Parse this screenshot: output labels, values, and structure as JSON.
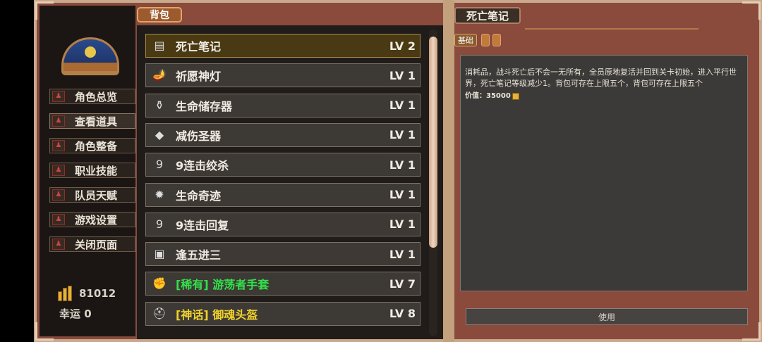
{
  "sidebar": {
    "nav": [
      {
        "label": "角色总览"
      },
      {
        "label": "查看道具"
      },
      {
        "label": "角色整备"
      },
      {
        "label": "职业技能"
      },
      {
        "label": "队员天赋"
      },
      {
        "label": "游戏设置"
      },
      {
        "label": "关闭页面"
      }
    ],
    "gold": "81012",
    "luck": "幸运 0"
  },
  "bag": {
    "tab_label": "背包",
    "items": [
      {
        "name": "死亡笔记",
        "level": "LV 2",
        "icon": "book-icon",
        "glyph": "▤"
      },
      {
        "name": "祈愿神灯",
        "level": "LV 1",
        "icon": "lamp-icon",
        "glyph": "🪔"
      },
      {
        "name": "生命储存器",
        "level": "LV 1",
        "icon": "vessel-icon",
        "glyph": "⚱"
      },
      {
        "name": "减伤圣器",
        "level": "LV 1",
        "icon": "relic-icon",
        "glyph": "◆"
      },
      {
        "name": "9连击绞杀",
        "level": "LV 1",
        "icon": "nine-icon",
        "glyph": "9"
      },
      {
        "name": "生命奇迹",
        "level": "LV 1",
        "icon": "gem-icon",
        "glyph": "✹"
      },
      {
        "name": "9连击回复",
        "level": "LV 1",
        "icon": "nine-small-icon",
        "glyph": "9"
      },
      {
        "name": "逢五进三",
        "level": "LV 1",
        "icon": "card-icon",
        "glyph": "▣"
      },
      {
        "name": "[稀有] 游荡者手套",
        "level": "LV 7",
        "icon": "glove-icon",
        "glyph": "✊",
        "rarity": "rare"
      },
      {
        "name": "[神话] 御魂头盔",
        "level": "LV 8",
        "icon": "helmet-icon",
        "glyph": "⛑",
        "rarity": "myth"
      }
    ]
  },
  "detail": {
    "title": "死亡笔记",
    "tab_basic": "基础",
    "description": "消耗品，战斗死亡后不会一无所有，全员原地复活并回到关卡初始，进入平行世界，死亡笔记等级减少1。背包可存在上限五个，背包可存在上限五个",
    "value": "价值：35000",
    "use_label": "使用"
  },
  "colors": {
    "rare": "#33e04a",
    "myth": "#f0d22a"
  }
}
